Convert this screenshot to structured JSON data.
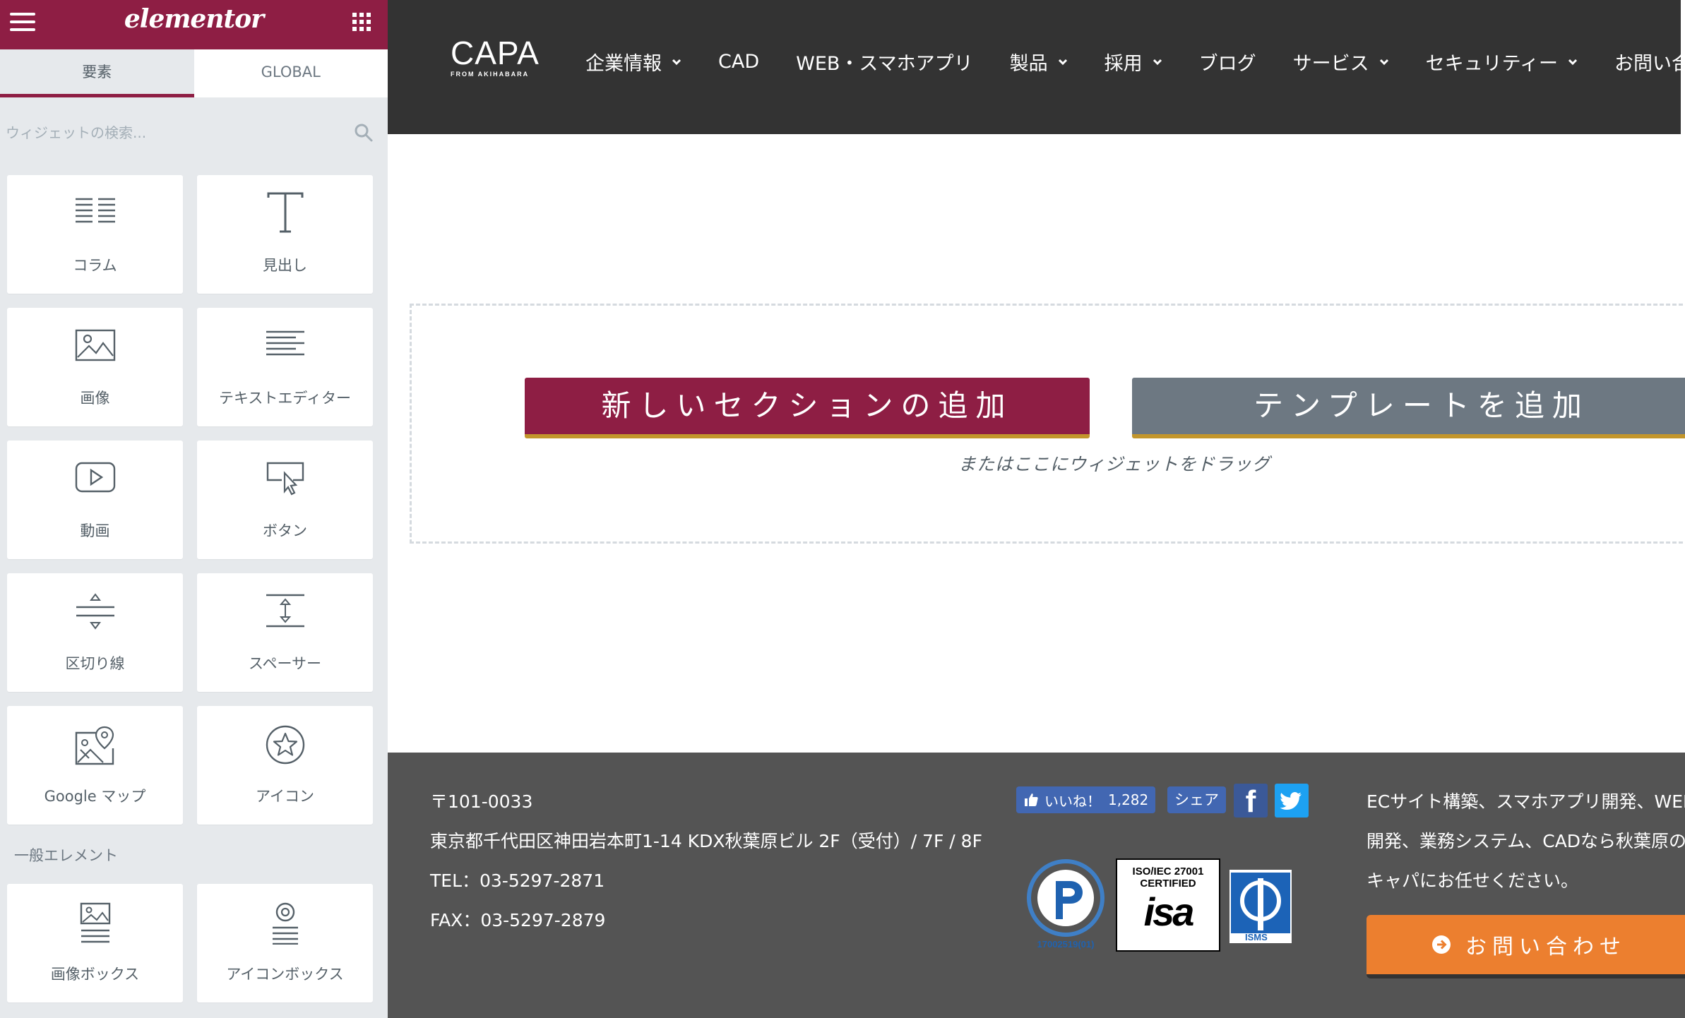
{
  "panel": {
    "logo": "elementor",
    "tabs": [
      {
        "label": "要素"
      },
      {
        "label": "GLOBAL"
      }
    ],
    "search": {
      "placeholder": "ウィジェットの検索..."
    },
    "widgets": [
      {
        "label": "コラム",
        "icon": "columns-icon"
      },
      {
        "label": "見出し",
        "icon": "heading-icon"
      },
      {
        "label": "画像",
        "icon": "image-icon"
      },
      {
        "label": "テキストエディター",
        "icon": "text-editor-icon"
      },
      {
        "label": "動画",
        "icon": "video-icon"
      },
      {
        "label": "ボタン",
        "icon": "button-icon"
      },
      {
        "label": "区切り線",
        "icon": "divider-icon"
      },
      {
        "label": "スペーサー",
        "icon": "spacer-icon"
      },
      {
        "label": "Google マップ",
        "icon": "google-maps-icon"
      },
      {
        "label": "アイコン",
        "icon": "star-icon"
      }
    ],
    "category": "一般エレメント",
    "general_widgets": [
      {
        "label": "画像ボックス",
        "icon": "image-box-icon"
      },
      {
        "label": "アイコンボックス",
        "icon": "icon-box-icon"
      }
    ]
  },
  "site": {
    "logo": {
      "main": "CAPA",
      "sub": "FROM AKIHABARA"
    },
    "nav": [
      {
        "label": "企業情報",
        "dropdown": true
      },
      {
        "label": "CAD",
        "dropdown": false
      },
      {
        "label": "WEB・スマホアプリ",
        "dropdown": false
      },
      {
        "label": "製品",
        "dropdown": true
      },
      {
        "label": "採用",
        "dropdown": true
      },
      {
        "label": "ブログ",
        "dropdown": false
      },
      {
        "label": "サービス",
        "dropdown": true
      },
      {
        "label": "セキュリティー",
        "dropdown": true
      },
      {
        "label": "お問い合わ",
        "dropdown": false
      }
    ]
  },
  "editor": {
    "add_section_label": "新しいセクションの追加",
    "add_template_label": "テンプレートを追加",
    "drag_hint": "またはここにウィジェットをドラッグ"
  },
  "footer": {
    "postal": "〒101-0033",
    "address": "東京都千代田区神田岩本町1-14 KDX秋葉原ビル 2F（受付）/ 7F / 8F",
    "tel": "TEL：03-5297-2871",
    "fax": "FAX：03-5297-2879",
    "like_label": "いいね！",
    "like_count": "1,282",
    "share_label": "シェア",
    "iso_line1": "ISO/IEC 27001",
    "iso_line2": "CERTIFIED",
    "iso_logo": "isa",
    "privacy_number": "17002519(01)",
    "isms_label": "ISMS",
    "desc_line1": "ECサイト構築、スマホアプリ開発、WEB",
    "desc_line2": "開発、業務システム、CADなら秋葉原のシ",
    "desc_line3": "キャパにお任せください。",
    "contact_label": "お問い合わせ"
  },
  "colors": {
    "brand": "#8e1e44",
    "header_bg": "#333333",
    "footer_bg": "#545454",
    "template_button": "#6d7882",
    "contact_button": "#ec7f2f",
    "accent_border": "#c3962c"
  }
}
